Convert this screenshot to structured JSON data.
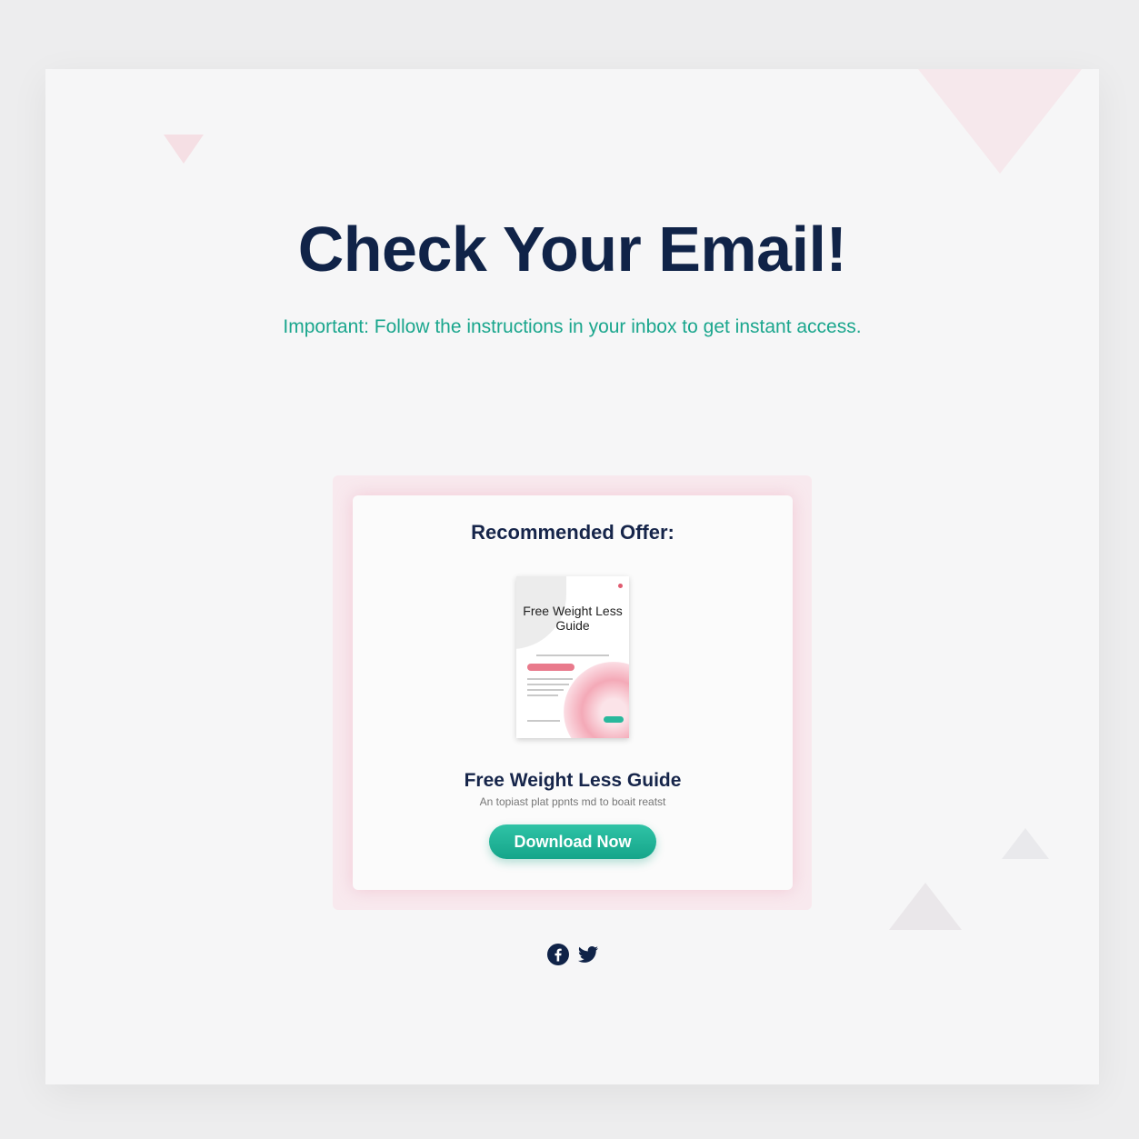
{
  "page": {
    "title": "Check Your Email!",
    "subtitle": "Important: Follow the instructions in your inbox to get instant access."
  },
  "offer": {
    "heading": "Recommended Offer:",
    "book_title": "Free Weight Less Guide",
    "name": "Free Weight Less Guide",
    "description": "An topiast plat ppnts md to boait reatst",
    "button_label": "Download Now"
  },
  "social": {
    "icons": [
      "facebook-icon",
      "twitter-icon"
    ]
  },
  "colors": {
    "title": "#102348",
    "accent": "#1aa68d",
    "button": "#15a58a",
    "glow": "#f5c3cf"
  }
}
